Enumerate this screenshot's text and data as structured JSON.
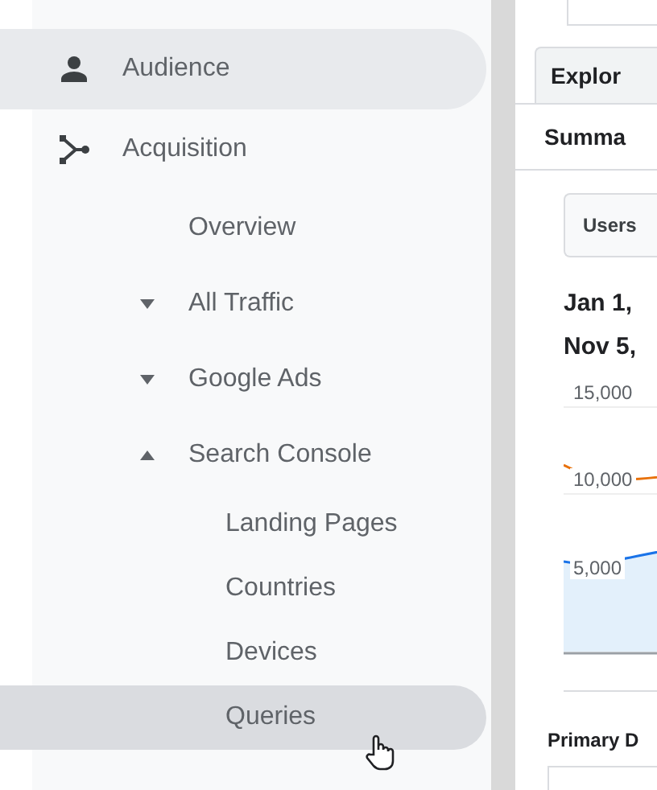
{
  "sidebar": {
    "items": [
      {
        "label": "Audience",
        "kind": "person",
        "selected": true
      },
      {
        "label": "Acquisition",
        "kind": "branch",
        "selected": false,
        "children": [
          {
            "label": "Overview",
            "selected": false
          },
          {
            "label": "All Traffic",
            "expanded": false,
            "selected": false
          },
          {
            "label": "Google Ads",
            "expanded": false,
            "selected": false
          },
          {
            "label": "Search Console",
            "expanded": true,
            "selected": false,
            "children": [
              {
                "label": "Landing Pages",
                "selected": false
              },
              {
                "label": "Countries",
                "selected": false
              },
              {
                "label": "Devices",
                "selected": false
              },
              {
                "label": "Queries",
                "selected": true
              }
            ]
          }
        ]
      }
    ]
  },
  "report": {
    "tab": "Explor",
    "section": "Summa",
    "metric_button": "Users",
    "date_range": [
      "Jan 1,",
      "Nov 5,"
    ],
    "y_labels": [
      "15,000",
      "10,000",
      "5,000"
    ],
    "footer_label": "Primary D"
  }
}
